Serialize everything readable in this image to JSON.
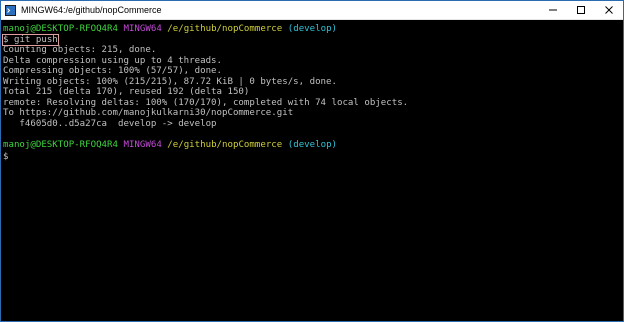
{
  "window": {
    "title": "MINGW64:/e/github/nopCommerce",
    "accent_color": "#2b6cb0"
  },
  "colors": {
    "user": "#3fd33f",
    "env": "#c24bd6",
    "path": "#cfcf3a",
    "branch": "#2fc3d8",
    "text": "#c0c0c0"
  },
  "prompt1": {
    "user_host": "manoj@DESKTOP-RFOQ4R4",
    "env": "MINGW64",
    "path": "/e/github/nopCommerce",
    "branch": "(develop)"
  },
  "command": {
    "symbol": "$",
    "text": "git push"
  },
  "output": [
    "Counting objects: 215, done.",
    "Delta compression using up to 4 threads.",
    "Compressing objects: 100% (57/57), done.",
    "Writing objects: 100% (215/215), 87.72 KiB | 0 bytes/s, done.",
    "Total 215 (delta 170), reused 192 (delta 150)",
    "remote: Resolving deltas: 100% (170/170), completed with 74 local objects.",
    "To https://github.com/manojkulkarni30/nopCommerce.git",
    "   f4605d0..d5a27ca  develop -> develop"
  ],
  "prompt2": {
    "user_host": "manoj@DESKTOP-RFOQ4R4",
    "env": "MINGW64",
    "path": "/e/github/nopCommerce",
    "branch": "(develop)",
    "symbol": "$"
  }
}
